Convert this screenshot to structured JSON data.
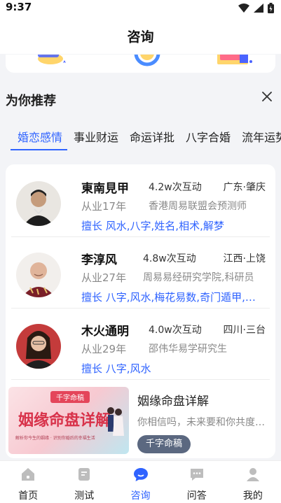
{
  "status": {
    "time": "9:37"
  },
  "header": {
    "title": "咨询"
  },
  "recommend": {
    "title": "为你推荐",
    "tabs": [
      "婚恋感情",
      "事业财运",
      "命运详批",
      "八字合婚",
      "流年运势"
    ],
    "active_tab": 0
  },
  "advisors": [
    {
      "name": "東南見甲",
      "years": "从业17年",
      "interactions": "4.2w次互动",
      "region": "广东·肇庆",
      "org": "香港周易联盟会预测师",
      "skills": "擅长 风水,八字,姓名,相术,解梦"
    },
    {
      "name": "李淳风",
      "years": "从业27年",
      "interactions": "4.8w次互动",
      "region": "江西·上饶",
      "org": "周易易经研究学院,科研员",
      "skills": "擅长 八字,风水,梅花易数,奇门遁甲,六爻"
    },
    {
      "name": "木火通明",
      "years": "从业29年",
      "interactions": "4.0w次互动",
      "region": "四川·三台",
      "org": "邵伟华易学研究生",
      "skills": "擅长 八字,风水"
    }
  ],
  "promo": {
    "title": "姻缘命盘详解",
    "desc": "你相信吗，未来要和你共度一生的人",
    "tag": "千字命稿",
    "image_banner": "千字命稿",
    "image_text": "姻缘命盘详解",
    "image_sub": "解析你今生的姻缘 · 识别你婚后的幸福生活"
  },
  "bottom_nav": {
    "items": [
      {
        "label": "首页",
        "icon": "home-icon"
      },
      {
        "label": "测试",
        "icon": "test-icon"
      },
      {
        "label": "咨询",
        "icon": "chat-icon"
      },
      {
        "label": "问答",
        "icon": "qa-icon"
      },
      {
        "label": "我的",
        "icon": "profile-icon"
      }
    ],
    "active": 2
  },
  "colors": {
    "accent": "#2f63ff",
    "muted": "#8a8a8a",
    "tag_bg": "#5b6880"
  }
}
